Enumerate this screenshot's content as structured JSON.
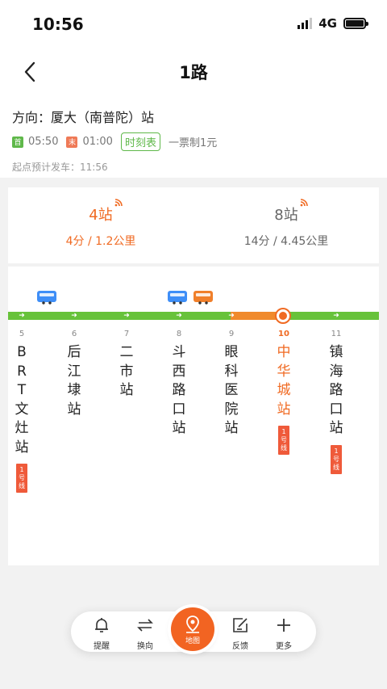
{
  "status": {
    "time": "10:56",
    "network": "4G"
  },
  "header": {
    "title": "1路"
  },
  "route": {
    "direction": "方向：厦大（南普陀）站",
    "start_tag": "首",
    "start_time": "05:50",
    "end_tag": "末",
    "end_time": "01:00",
    "timetable_label": "时刻表",
    "fare": "一票制1元",
    "departure": "起点预计发车：11:56"
  },
  "arrivals": [
    {
      "stops": "4站",
      "detail": "4分 / 1.2公里"
    },
    {
      "stops": "8站",
      "detail": "14分 / 4.45公里"
    }
  ],
  "stations": [
    {
      "num": "5",
      "name": "BRT文灶站",
      "transfer": "1号线"
    },
    {
      "num": "6",
      "name": "后江埭站",
      "transfer": ""
    },
    {
      "num": "7",
      "name": "二市站",
      "transfer": ""
    },
    {
      "num": "8",
      "name": "斗西路口站",
      "transfer": ""
    },
    {
      "num": "9",
      "name": "眼科医院站",
      "transfer": ""
    },
    {
      "num": "10",
      "name": "中华城站",
      "transfer": "1号线"
    },
    {
      "num": "11",
      "name": "镇海路口站",
      "transfer": "1号线"
    }
  ],
  "bottom_nav": {
    "remind": "提醒",
    "reverse": "换向",
    "map": "地图",
    "feedback": "反馈",
    "more": "更多"
  },
  "colors": {
    "accent": "#f06a22",
    "line": "#67c23a",
    "bus_blue": "#3e8ef7",
    "bus_orange": "#f07f2a"
  }
}
